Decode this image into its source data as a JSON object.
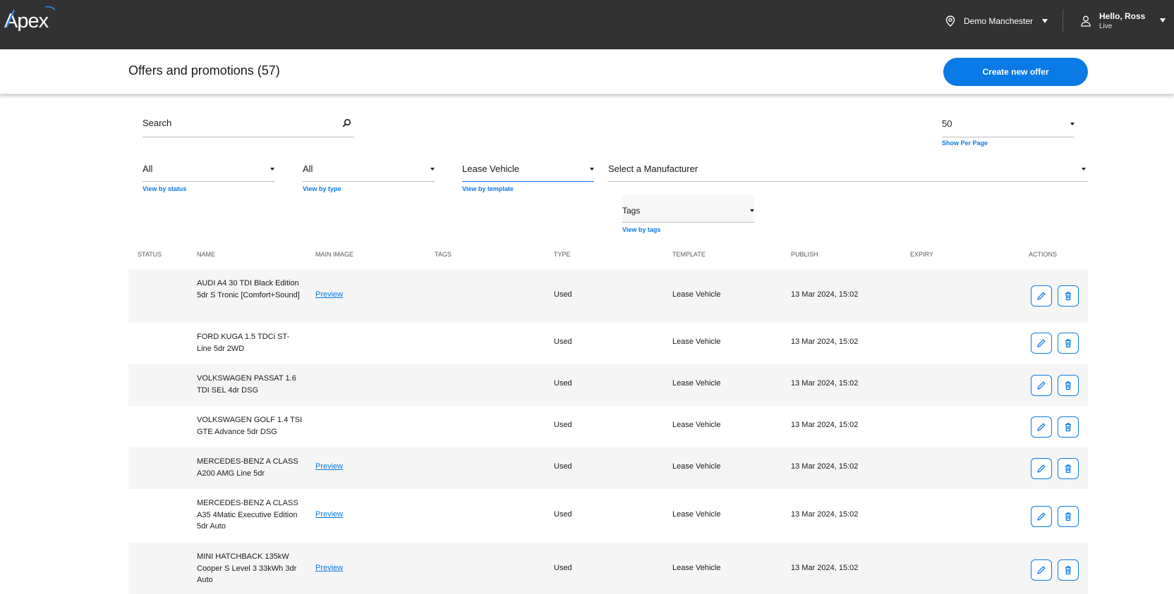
{
  "topbar": {
    "logo_text": "Apex",
    "location": "Demo Manchester",
    "user_greeting": "Hello, Ross",
    "user_env": "Live"
  },
  "header": {
    "title": "Offers and promotions (57)",
    "create_label": "Create new offer"
  },
  "filters": {
    "search_placeholder": "Search",
    "per_page": {
      "value": "50",
      "hint": "Show Per Page"
    },
    "status": {
      "value": "All",
      "hint": "View by status"
    },
    "type": {
      "value": "All",
      "hint": "View by type"
    },
    "template": {
      "value": "Lease Vehicle",
      "hint": "View by template"
    },
    "manufacturer": {
      "value": "Select a Manufacturer"
    },
    "tags": {
      "value": "Tags",
      "hint": "View by tags"
    }
  },
  "table": {
    "columns": [
      "STATUS",
      "NAME",
      "MAIN IMAGE",
      "TAGS",
      "TYPE",
      "TEMPLATE",
      "PUBLISH",
      "EXPIRY",
      "ACTIONS"
    ],
    "preview_label": "Preview",
    "rows": [
      {
        "name": "AUDI A4 30 TDI Black Edition 5dr S Tronic [Comfort+Sound]",
        "image": "Preview",
        "type": "Used",
        "template": "Lease Vehicle",
        "publish": "13 Mar 2024, 15:02"
      },
      {
        "name": "FORD KUGA 1.5 TDCi ST-Line 5dr 2WD",
        "image": "",
        "type": "Used",
        "template": "Lease Vehicle",
        "publish": "13 Mar 2024, 15:02"
      },
      {
        "name": "VOLKSWAGEN PASSAT 1.6 TDI SEL 4dr DSG",
        "image": "",
        "type": "Used",
        "template": "Lease Vehicle",
        "publish": "13 Mar 2024, 15:02"
      },
      {
        "name": "VOLKSWAGEN GOLF 1.4 TSI GTE Advance 5dr DSG",
        "image": "",
        "type": "Used",
        "template": "Lease Vehicle",
        "publish": "13 Mar 2024, 15:02"
      },
      {
        "name": "MERCEDES-BENZ A CLASS A200 AMG Line 5dr",
        "image": "Preview",
        "type": "Used",
        "template": "Lease Vehicle",
        "publish": "13 Mar 2024, 15:02"
      },
      {
        "name": "MERCEDES-BENZ A CLASS A35 4Matic Executive Edition 5dr Auto",
        "image": "Preview",
        "type": "Used",
        "template": "Lease Vehicle",
        "publish": "13 Mar 2024, 15:02"
      },
      {
        "name": "MINI HATCHBACK 135kW Cooper S Level 3 33kWh 3dr Auto",
        "image": "Preview",
        "type": "Used",
        "template": "Lease Vehicle",
        "publish": "13 Mar 2024, 15:02"
      }
    ]
  },
  "colors": {
    "topbar": "#323232",
    "accent": "#0a7ae6",
    "row_shade": "#f5f5f5"
  },
  "icons": [
    "location-pin-icon",
    "user-icon",
    "search-icon",
    "chevron-down-icon",
    "edit-pencil-icon",
    "trash-icon"
  ]
}
